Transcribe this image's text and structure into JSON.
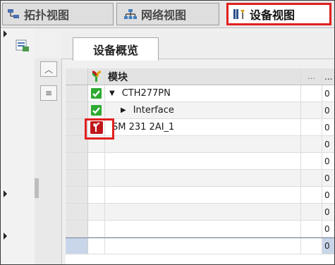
{
  "view_tabs": {
    "topology": "拓扑视图",
    "network": "网络视图",
    "device": "设备视图"
  },
  "editor_tab": "设备概览",
  "table": {
    "header": {
      "module": "模块",
      "col3": "...",
      "col4": "..."
    },
    "rows": [
      {
        "name": "CTH277PN",
        "status": "ok",
        "col4": "0",
        "expander": "down"
      },
      {
        "name": "Interface",
        "status": "ok",
        "col4": "0",
        "expander": "right"
      },
      {
        "name": "SM 231 2AI_1",
        "status": "error",
        "col4": "0"
      },
      {
        "name": "",
        "col4": "0"
      },
      {
        "name": "",
        "col4": "0"
      },
      {
        "name": "",
        "col4": "0"
      },
      {
        "name": "",
        "col4": "0"
      },
      {
        "name": "",
        "col4": "0"
      },
      {
        "name": "",
        "col4": "0"
      },
      {
        "name": "",
        "col4": "0"
      }
    ]
  },
  "colors": {
    "highlight": "#e0201e",
    "ok_green": "#2eaa32",
    "error_red": "#c0161a",
    "selection": "#c9d6ea"
  },
  "icons": {
    "topology": "topology-icon",
    "network": "network-icon",
    "device": "device-icon",
    "overview": "overview-icon",
    "module": "wrench-status-icon"
  }
}
